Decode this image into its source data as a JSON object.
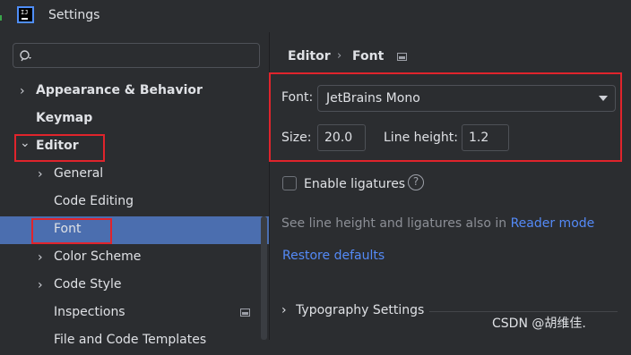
{
  "window": {
    "title": "Settings"
  },
  "search": {
    "placeholder": ""
  },
  "sidebar": {
    "items": [
      {
        "label": "Appearance & Behavior",
        "chevron": "›",
        "bold": true
      },
      {
        "label": "Keymap",
        "chevron": "",
        "bold": true
      },
      {
        "label": "Editor",
        "chevron": "⌄",
        "bold": true
      },
      {
        "label": "General",
        "chevron": "›"
      },
      {
        "label": "Code Editing",
        "chevron": ""
      },
      {
        "label": "Font",
        "chevron": "",
        "selected": true
      },
      {
        "label": "Color Scheme",
        "chevron": "›"
      },
      {
        "label": "Code Style",
        "chevron": "›"
      },
      {
        "label": "Inspections",
        "chevron": ""
      },
      {
        "label": "File and Code Templates",
        "chevron": ""
      }
    ]
  },
  "breadcrumb": {
    "parent": "Editor",
    "separator": "›",
    "current": "Font"
  },
  "font": {
    "label": "Font:",
    "value": "JetBrains Mono",
    "size_label": "Size:",
    "size_value": "20.0",
    "line_height_label": "Line height:",
    "line_height_value": "1.2"
  },
  "ligatures": {
    "label": "Enable ligatures",
    "checked": false,
    "help_glyph": "?"
  },
  "hint": {
    "text": "See line height and ligatures also in ",
    "link": "Reader mode"
  },
  "restore": {
    "label": "Restore defaults"
  },
  "typography": {
    "chevron": "›",
    "label": "Typography Settings"
  },
  "watermark": {
    "text": "CSDN @胡维佳."
  },
  "colors": {
    "selection": "#4b6eaf",
    "link": "#548af7",
    "highlight_box": "#e0242c"
  },
  "icons": [
    "intellij-app-icon",
    "search-icon",
    "project-scope-icon",
    "help-icon",
    "dropdown-arrow-icon"
  ]
}
